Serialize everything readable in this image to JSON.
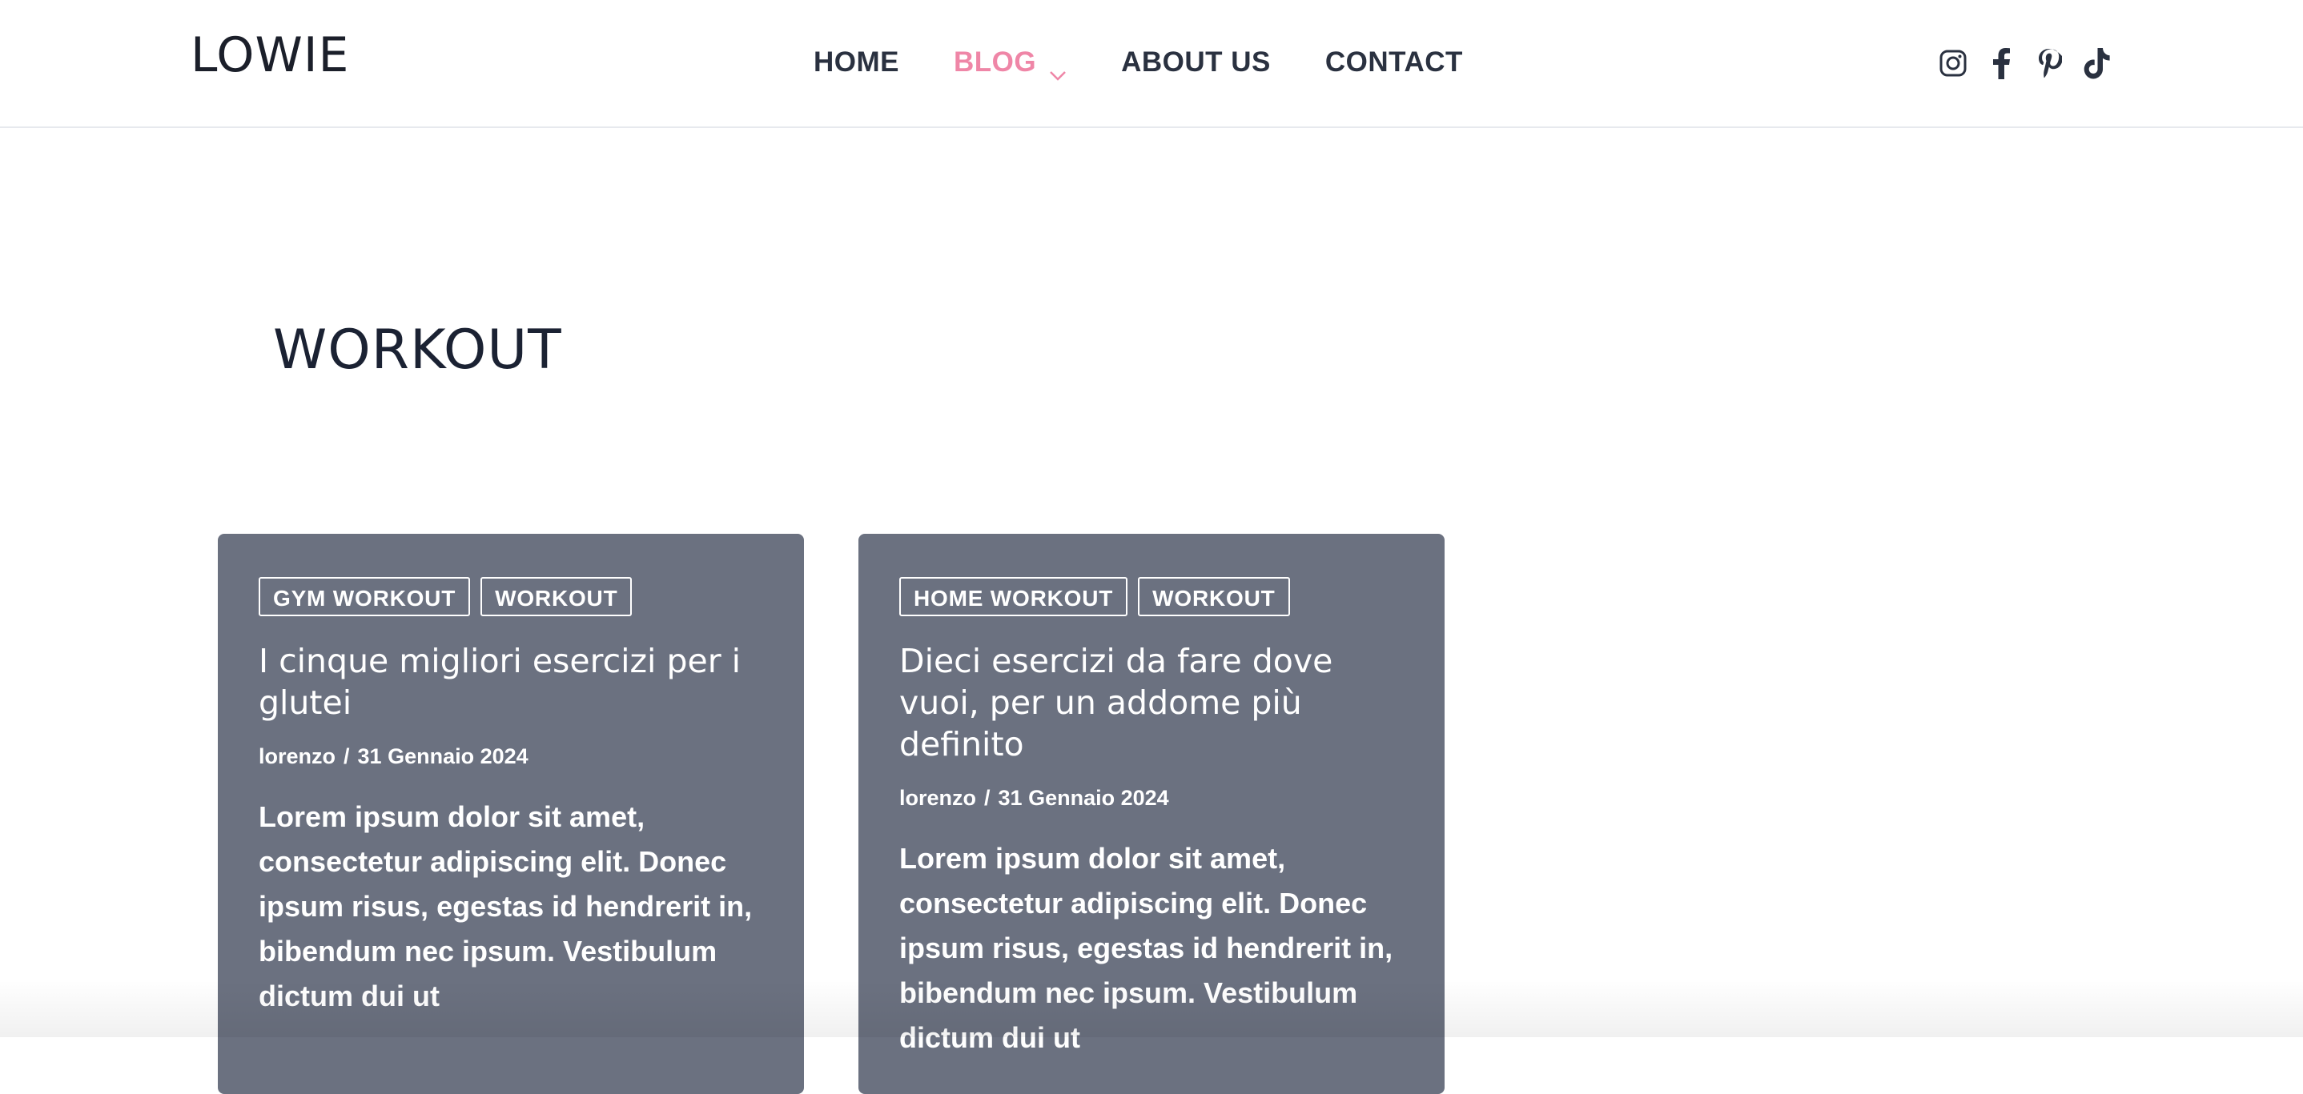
{
  "header": {
    "logo": "LOWIE",
    "nav": [
      {
        "label": "HOME",
        "active": false
      },
      {
        "label": "BLOG",
        "active": true,
        "has_dropdown": true
      },
      {
        "label": "ABOUT US",
        "active": false
      },
      {
        "label": "CONTACT",
        "active": false
      }
    ],
    "social_icons": [
      "instagram-icon",
      "facebook-icon",
      "pinterest-icon",
      "tiktok-icon"
    ],
    "accent_color": "#ef86a7"
  },
  "page": {
    "title": "WORKOUT"
  },
  "posts": [
    {
      "tags": [
        "GYM WORKOUT",
        "WORKOUT"
      ],
      "title": "I cinque migliori esercizi per i glutei",
      "author": "lorenzo",
      "separator": "/",
      "date": "31 Gennaio 2024",
      "excerpt": "Lorem ipsum dolor sit amet, consectetur adipiscing elit. Donec ipsum risus, egestas id hendrerit in, bibendum nec ipsum. Vestibulum dictum dui ut"
    },
    {
      "tags": [
        "HOME WORKOUT",
        "WORKOUT"
      ],
      "title": "Dieci esercizi da fare dove vuoi, per un addome più definito",
      "author": "lorenzo",
      "separator": "/",
      "date": "31 Gennaio 2024",
      "excerpt": "Lorem ipsum dolor sit amet, consectetur adipiscing elit. Donec ipsum risus, egestas id hendrerit in, bibendum nec ipsum. Vestibulum dictum dui ut"
    }
  ],
  "colors": {
    "card_background": "#6b7180",
    "text_dark": "#1b2233",
    "nav_text": "#2a3140"
  }
}
